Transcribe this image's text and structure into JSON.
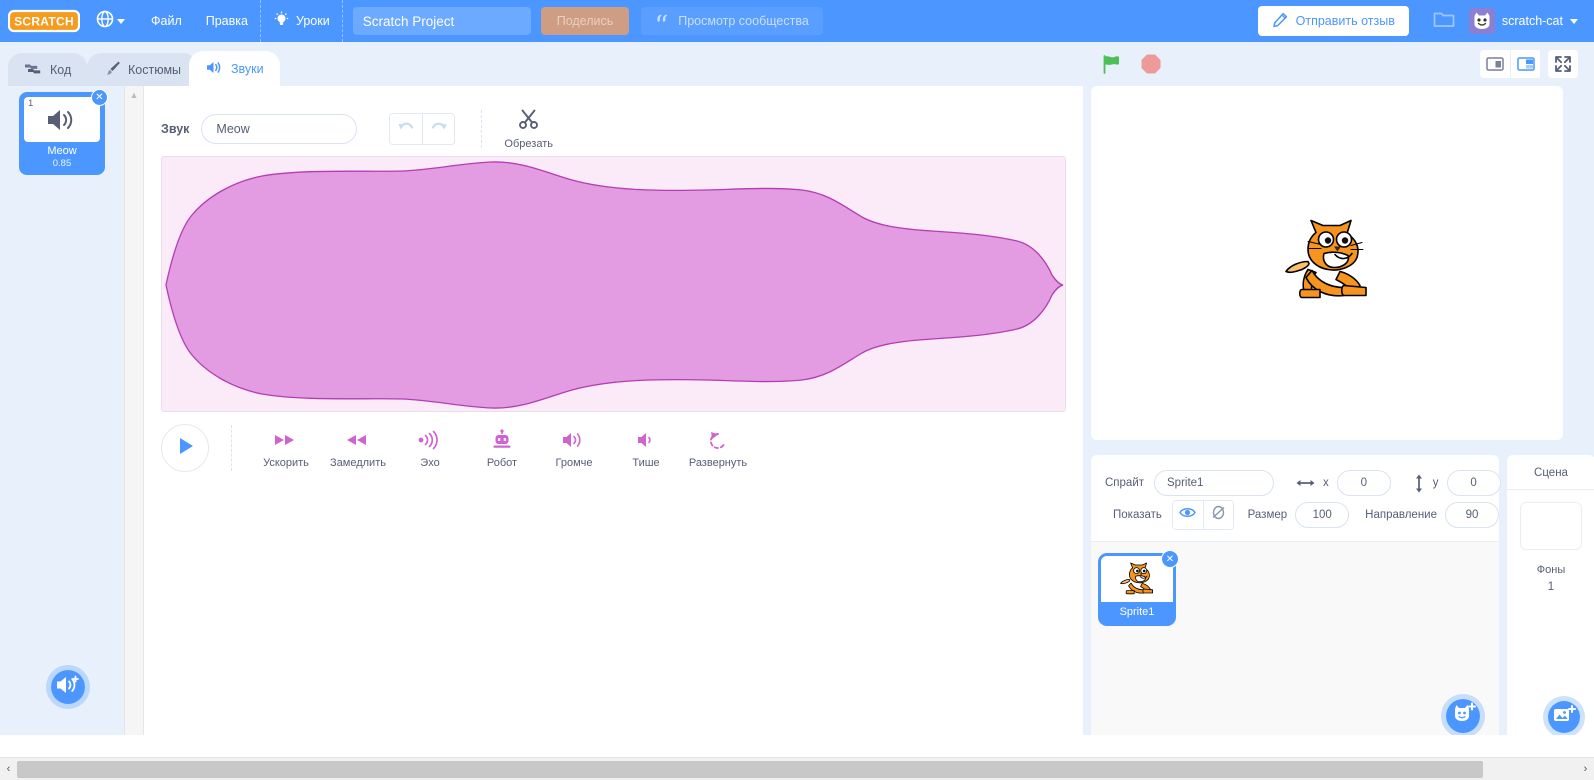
{
  "menubar": {
    "logo_text": "SCRATCH",
    "globe_icon": "globe-icon",
    "file_label": "Файл",
    "edit_label": "Правка",
    "tutorials_label": "Уроки",
    "tutorials_icon": "lightbulb-icon",
    "project_title": "Scratch Project",
    "project_title_placeholder": "Scratch Project",
    "share_label": "Поделись",
    "community_label": "Просмотр сообщества",
    "community_icon": "community-icon",
    "feedback_label": "Отправить отзыв",
    "feedback_icon": "pencil-icon",
    "folder_icon": "folder-icon",
    "account_name": "scratch-cat",
    "account_avatar": "cat-avatar-icon",
    "accent_blue": "#4C97FF",
    "share_bg": "#CF9D83"
  },
  "tabs": [
    {
      "label": "Код",
      "icon": "blocks-icon",
      "active": false
    },
    {
      "label": "Костюмы",
      "icon": "paintbrush-icon",
      "active": false
    },
    {
      "label": "Звуки",
      "icon": "speaker-icon",
      "active": true
    }
  ],
  "stage_controls": {
    "green_flag_icon": "green-flag-icon",
    "stop_icon": "stop-octagon-icon",
    "small_stage_icon": "small-stage-icon",
    "large_stage_icon": "large-stage-icon",
    "fullscreen_icon": "fullscreen-icon",
    "selected_size": "large",
    "flag_color": "#4CBF56",
    "stop_color": "#EC9A9A"
  },
  "sound_list": {
    "items": [
      {
        "index": "1",
        "name": "Meow",
        "duration": "0.85",
        "icon": "speaker-icon",
        "selected": true
      }
    ],
    "add_button_icon": "add-sound-icon"
  },
  "sound_editor": {
    "name_label": "Звук",
    "name_value": "Meow",
    "undo_icon": "undo-icon",
    "redo_icon": "redo-icon",
    "trim_label": "Обрезать",
    "trim_icon": "scissors-icon",
    "play_icon": "play-icon",
    "waveform_fill": "#D97BD9",
    "waveform_bg": "#FBEBF8",
    "waveform_stroke": "#B33DB3",
    "effects": [
      {
        "label": "Ускорить",
        "icon": "fast-forward-icon"
      },
      {
        "label": "Замедлить",
        "icon": "rewind-icon"
      },
      {
        "label": "Эхо",
        "icon": "echo-icon"
      },
      {
        "label": "Робот",
        "icon": "robot-icon"
      },
      {
        "label": "Громче",
        "icon": "volume-up-icon"
      },
      {
        "label": "Тише",
        "icon": "volume-down-icon"
      },
      {
        "label": "Развернуть",
        "icon": "reverse-icon"
      }
    ]
  },
  "sprite_pane": {
    "sprite_label": "Спрайт",
    "sprite_name": "Sprite1",
    "x_label": "x",
    "x_value": "0",
    "y_label": "y",
    "y_value": "0",
    "show_label": "Показать",
    "show_icon": "eye-icon",
    "hide_icon": "eye-slash-icon",
    "size_label": "Размер",
    "size_value": "100",
    "direction_label": "Направление",
    "direction_value": "90",
    "sprites": [
      {
        "name": "Sprite1",
        "selected": true,
        "thumb_icon": "scratch-cat-icon"
      }
    ],
    "add_sprite_icon": "add-sprite-icon"
  },
  "stage_selector": {
    "header": "Сцена",
    "backdrops_label": "Фоны",
    "backdrops_count": "1",
    "add_backdrop_icon": "add-backdrop-icon"
  },
  "scrollbar": {
    "left_arrow": "‹",
    "right_arrow": "›"
  }
}
